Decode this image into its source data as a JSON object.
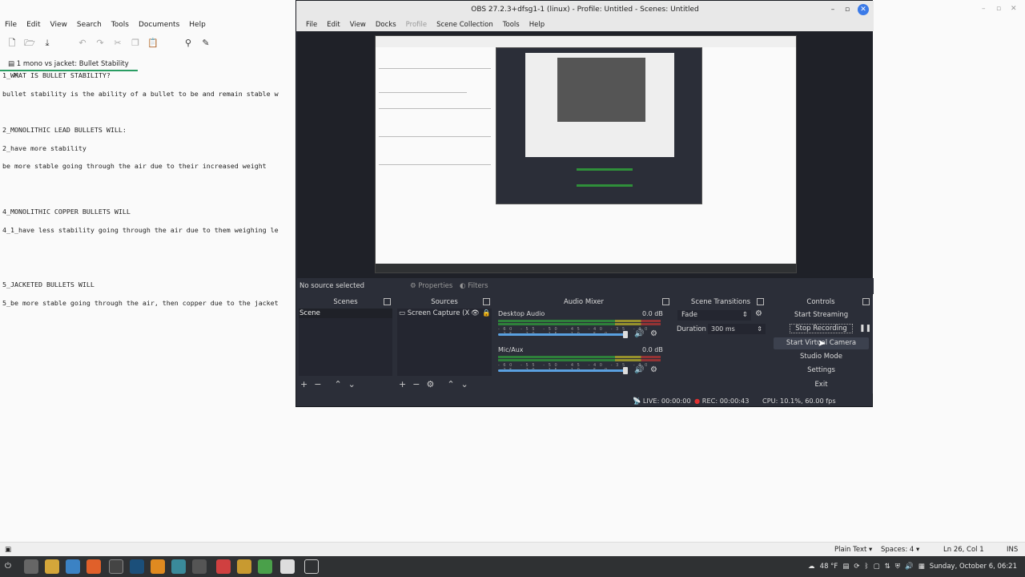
{
  "editor": {
    "menu": [
      "File",
      "Edit",
      "View",
      "Search",
      "Tools",
      "Documents",
      "Help"
    ],
    "tab_label": "1 mono vs jacket: Bullet Stability",
    "tab_close": "×",
    "lines": [
      "1_WHAT IS BULLET STABILITY?",
      "",
      "bullet stability is the ability of a bullet to be and remain stable w",
      "",
      "",
      "",
      "2_MONOLITHIC LEAD BULLETS WILL:",
      "",
      "2_have more stability",
      "",
      "be more stable going through the air due to their increased weight",
      "",
      "",
      "",
      "",
      "4_MONOLITHIC COPPER BULLETS WILL",
      "",
      "4_1_have less stability going through the air due to them weighing le",
      "",
      "",
      "",
      "",
      "",
      "5_JACKETED BULLETS WILL",
      "",
      "5_be more stable going through the air, then copper due to the jacket"
    ],
    "status": {
      "syntax": "Plain Text",
      "spaces": "Spaces: 4",
      "position": "Ln 26, Col 1",
      "mode": "INS"
    }
  },
  "obs": {
    "title": "OBS 27.2.3+dfsg1-1 (linux) - Profile: Untitled - Scenes: Untitled",
    "menu": [
      "File",
      "Edit",
      "View",
      "Docks",
      "Profile",
      "Scene Collection",
      "Tools",
      "Help"
    ],
    "no_source": "No source selected",
    "properties_label": "Properties",
    "filters_label": "Filters",
    "scenes": {
      "title": "Scenes",
      "items": [
        "Scene"
      ]
    },
    "sources": {
      "title": "Sources",
      "items": [
        "Screen Capture (X"
      ]
    },
    "mixer": {
      "title": "Audio Mixer",
      "channels": [
        {
          "name": "Desktop Audio",
          "db": "0.0 dB",
          "level": 0.95
        },
        {
          "name": "Mic/Aux",
          "db": "0.0 dB",
          "level": 0.95
        }
      ],
      "ticks": "-60 -55 -50 -45 -40 -35 -30 -25 -20 -15 -10 -5 0"
    },
    "transitions": {
      "title": "Scene Transitions",
      "type": "Fade",
      "duration_label": "Duration",
      "duration_value": "300 ms"
    },
    "controls": {
      "title": "Controls",
      "start_streaming": "Start Streaming",
      "stop_recording": "Stop Recording",
      "start_virtual_camera": "Start Virtual Camera",
      "studio_mode": "Studio Mode",
      "settings": "Settings",
      "exit": "Exit"
    },
    "status": {
      "live": "LIVE: 00:00:00",
      "rec": "REC: 00:00:43",
      "cpu": "CPU: 10.1%, 60.00 fps"
    }
  },
  "taskbar": {
    "weather": "48 °F",
    "clock": "Sunday, October 6, 06:21"
  }
}
